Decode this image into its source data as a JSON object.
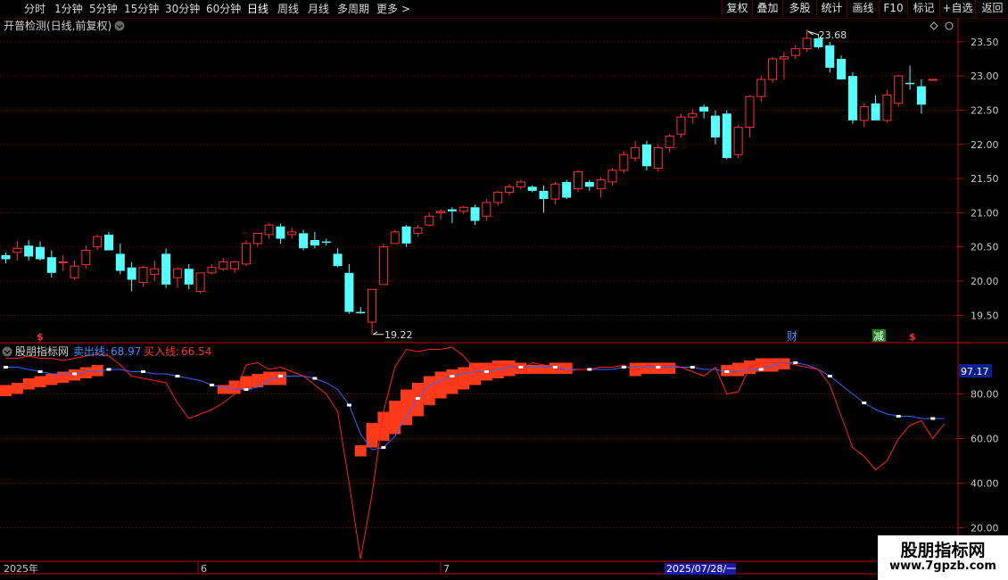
{
  "toolbar": {
    "periods": [
      "分时",
      "1分钟",
      "5分钟",
      "15分钟",
      "30分钟",
      "60分钟",
      "日线",
      "周线",
      "月线",
      "多周期",
      "更多 >"
    ],
    "active_period": "日线",
    "right_buttons": [
      "复权",
      "叠加",
      "多股",
      "统计",
      "画线",
      "F10",
      "标记",
      "+自选",
      "返回"
    ]
  },
  "main_panel": {
    "title": "开普检测(日线,前复权)",
    "high_label": "23.68",
    "low_label": "19.22",
    "markers": {
      "s1": "$",
      "s2": "$",
      "cai": "财",
      "jian": "减"
    }
  },
  "indicator_panel": {
    "title": "股朋指标网",
    "sell_label": "卖出线:",
    "sell_value": "68.97",
    "buy_label": "买入线:",
    "buy_value": "66.54",
    "current_value": "97.17"
  },
  "time_axis": {
    "labels": [
      "2025年",
      "6",
      "7"
    ],
    "cursor_date": "2025/07/28/一"
  },
  "watermark": {
    "title": "股朋指标网",
    "url": "www.7gpzb.com"
  },
  "colors": {
    "up": "#ff3232",
    "down": "#54ffff",
    "sell_line": "#3366ff",
    "buy_line": "#ff2020",
    "block": "#ff3a1a",
    "grid": "#8a0000",
    "axis": "#c00000"
  },
  "chart_data": [
    {
      "type": "candlestick",
      "title": "开普检测(日线,前复权)",
      "y_ticks": [
        19.5,
        20.0,
        20.5,
        21.0,
        21.5,
        22.0,
        22.5,
        23.0,
        23.5
      ],
      "ylim": [
        19.1,
        23.85
      ],
      "ohlc": [
        [
          20.38,
          20.42,
          20.26,
          20.32
        ],
        [
          20.42,
          20.58,
          20.3,
          20.48
        ],
        [
          20.52,
          20.6,
          20.3,
          20.36
        ],
        [
          20.5,
          20.58,
          20.3,
          20.32
        ],
        [
          20.35,
          20.45,
          20.05,
          20.12
        ],
        [
          20.28,
          20.38,
          20.15,
          20.28
        ],
        [
          20.05,
          20.3,
          20.02,
          20.22
        ],
        [
          20.24,
          20.52,
          20.18,
          20.45
        ],
        [
          20.5,
          20.68,
          20.45,
          20.65
        ],
        [
          20.68,
          20.72,
          20.45,
          20.45
        ],
        [
          20.4,
          20.55,
          20.1,
          20.15
        ],
        [
          20.2,
          20.28,
          19.85,
          20.02
        ],
        [
          19.98,
          20.22,
          19.92,
          20.2
        ],
        [
          20.1,
          20.3,
          20.0,
          20.18
        ],
        [
          20.4,
          20.48,
          19.9,
          19.95
        ],
        [
          20.05,
          20.2,
          19.9,
          20.18
        ],
        [
          20.18,
          20.25,
          19.88,
          19.95
        ],
        [
          19.85,
          20.12,
          19.82,
          20.12
        ],
        [
          20.12,
          20.25,
          20.1,
          20.2
        ],
        [
          20.18,
          20.34,
          20.15,
          20.28
        ],
        [
          20.18,
          20.3,
          20.12,
          20.28
        ],
        [
          20.25,
          20.6,
          20.22,
          20.55
        ],
        [
          20.55,
          20.7,
          20.5,
          20.7
        ],
        [
          20.68,
          20.85,
          20.62,
          20.82
        ],
        [
          20.8,
          20.84,
          20.55,
          20.62
        ],
        [
          20.68,
          20.78,
          20.62,
          20.72
        ],
        [
          20.7,
          20.75,
          20.45,
          20.48
        ],
        [
          20.6,
          20.72,
          20.48,
          20.52
        ],
        [
          20.58,
          20.62,
          20.52,
          20.56
        ],
        [
          20.4,
          20.48,
          20.2,
          20.22
        ],
        [
          20.12,
          20.25,
          19.52,
          19.55
        ],
        [
          19.55,
          19.62,
          19.52,
          19.53
        ],
        [
          19.4,
          19.88,
          19.22,
          19.88
        ],
        [
          19.95,
          20.55,
          19.95,
          20.5
        ],
        [
          20.55,
          20.75,
          20.55,
          20.72
        ],
        [
          20.8,
          20.82,
          20.5,
          20.55
        ],
        [
          20.7,
          20.82,
          20.65,
          20.78
        ],
        [
          20.82,
          21.0,
          20.8,
          20.95
        ],
        [
          21.0,
          21.05,
          20.9,
          21.02
        ],
        [
          21.05,
          21.08,
          20.85,
          21.02
        ],
        [
          21.02,
          21.1,
          20.98,
          21.08
        ],
        [
          21.08,
          21.12,
          20.82,
          20.88
        ],
        [
          20.95,
          21.2,
          20.88,
          21.15
        ],
        [
          21.15,
          21.32,
          21.1,
          21.3
        ],
        [
          21.3,
          21.42,
          21.25,
          21.38
        ],
        [
          21.38,
          21.48,
          21.34,
          21.45
        ],
        [
          21.38,
          21.4,
          21.3,
          21.32
        ],
        [
          21.32,
          21.4,
          21.0,
          21.2
        ],
        [
          21.2,
          21.45,
          21.12,
          21.42
        ],
        [
          21.45,
          21.48,
          21.2,
          21.22
        ],
        [
          21.35,
          21.62,
          21.3,
          21.6
        ],
        [
          21.45,
          21.48,
          21.32,
          21.38
        ],
        [
          21.35,
          21.52,
          21.22,
          21.48
        ],
        [
          21.45,
          21.65,
          21.4,
          21.62
        ],
        [
          21.62,
          21.9,
          21.58,
          21.85
        ],
        [
          21.8,
          22.05,
          21.75,
          21.95
        ],
        [
          22.0,
          22.05,
          21.62,
          21.68
        ],
        [
          21.65,
          22.0,
          21.6,
          21.95
        ],
        [
          21.95,
          22.15,
          21.88,
          22.12
        ],
        [
          22.15,
          22.45,
          22.1,
          22.4
        ],
        [
          22.4,
          22.52,
          22.3,
          22.45
        ],
        [
          22.55,
          22.58,
          22.38,
          22.48
        ],
        [
          22.42,
          22.5,
          22.0,
          22.1
        ],
        [
          22.45,
          22.5,
          21.78,
          21.8
        ],
        [
          21.85,
          22.28,
          21.8,
          22.25
        ],
        [
          22.25,
          22.72,
          22.1,
          22.7
        ],
        [
          22.7,
          23.0,
          22.62,
          22.95
        ],
        [
          22.95,
          23.28,
          22.9,
          23.25
        ],
        [
          23.25,
          23.35,
          22.95,
          23.28
        ],
        [
          23.3,
          23.45,
          23.25,
          23.4
        ],
        [
          23.4,
          23.68,
          23.35,
          23.55
        ],
        [
          23.55,
          23.62,
          23.4,
          23.42
        ],
        [
          23.45,
          23.5,
          23.05,
          23.12
        ],
        [
          23.25,
          23.3,
          22.95,
          22.95
        ],
        [
          23.0,
          23.05,
          22.3,
          22.35
        ],
        [
          22.35,
          22.6,
          22.25,
          22.55
        ],
        [
          22.6,
          22.72,
          22.35,
          22.35
        ],
        [
          22.35,
          22.8,
          22.32,
          22.72
        ],
        [
          22.6,
          23.02,
          22.55,
          23.0
        ],
        [
          22.9,
          23.15,
          22.8,
          22.88
        ],
        [
          22.85,
          22.95,
          22.45,
          22.58
        ],
        [
          22.95,
          22.95,
          22.95,
          22.95
        ]
      ]
    },
    {
      "type": "line",
      "title": "股朋指标网",
      "y_ticks": [
        20.0,
        40.0,
        60.0,
        80.0
      ],
      "ylim": [
        5,
        103
      ],
      "series": [
        {
          "name": "卖出线",
          "values": [
            92,
            92,
            91,
            90,
            89,
            89,
            89,
            90,
            90,
            91,
            91,
            90,
            90,
            89,
            89,
            88,
            87,
            86,
            84,
            83,
            82,
            82,
            83,
            86,
            88,
            88,
            88,
            87,
            85,
            82,
            75,
            62,
            55,
            56,
            61,
            70,
            78,
            84,
            86,
            88,
            89,
            90,
            90,
            91,
            92,
            92,
            92,
            92,
            92,
            91,
            91,
            91,
            91,
            91,
            92,
            92,
            92,
            92,
            92,
            92,
            92,
            91,
            91,
            90,
            90,
            91,
            91,
            93,
            94,
            94,
            93,
            91,
            88,
            84,
            80,
            76,
            73,
            71,
            70,
            70,
            69,
            69,
            68.97
          ]
        },
        {
          "name": "买入线",
          "values": [
            96,
            96,
            97,
            96,
            96,
            95,
            96,
            97,
            98,
            97,
            93,
            88,
            87,
            86,
            85,
            76,
            69,
            71,
            73,
            76,
            80,
            93,
            94,
            91,
            92,
            90,
            88,
            84,
            80,
            72,
            40,
            6,
            35,
            72,
            92,
            100,
            99,
            100,
            100,
            101,
            97,
            91,
            93,
            93,
            93,
            91,
            94,
            93,
            92,
            90,
            91,
            91,
            92,
            92,
            93,
            90,
            93,
            92,
            93,
            92,
            90,
            88,
            92,
            80,
            81,
            92,
            94,
            94,
            94,
            93,
            92,
            91,
            84,
            70,
            56,
            52,
            46,
            50,
            60,
            66,
            68,
            60,
            66.54
          ]
        }
      ],
      "signal_blocks": [
        [
          0,
          82,
          81
        ],
        [
          1,
          82,
          83
        ],
        [
          2,
          84,
          85
        ],
        [
          3,
          85,
          86
        ],
        [
          4,
          86,
          87
        ],
        [
          5,
          87,
          88
        ],
        [
          6,
          88,
          89
        ],
        [
          7,
          89,
          90
        ],
        [
          8,
          90,
          91
        ],
        [
          19,
          82,
          82
        ],
        [
          20,
          82,
          84
        ],
        [
          21,
          84,
          86
        ],
        [
          22,
          85,
          87
        ],
        [
          23,
          86,
          88
        ],
        [
          24,
          86,
          88
        ],
        [
          31,
          54,
          55
        ],
        [
          32,
          58,
          65
        ],
        [
          33,
          61,
          70
        ],
        [
          34,
          64,
          75
        ],
        [
          35,
          68,
          80
        ],
        [
          36,
          72,
          83
        ],
        [
          37,
          77,
          86
        ],
        [
          38,
          80,
          88
        ],
        [
          39,
          82,
          89
        ],
        [
          40,
          84,
          90
        ],
        [
          41,
          86,
          92
        ],
        [
          42,
          88,
          92
        ],
        [
          43,
          89,
          93
        ],
        [
          44,
          90,
          93
        ],
        [
          45,
          91,
          92
        ],
        [
          46,
          91,
          91
        ],
        [
          47,
          91,
          91
        ],
        [
          48,
          91,
          92
        ],
        [
          49,
          91,
          92
        ],
        [
          55,
          90,
          92
        ],
        [
          56,
          91,
          92
        ],
        [
          57,
          91,
          92
        ],
        [
          58,
          91,
          92
        ],
        [
          63,
          90,
          91
        ],
        [
          64,
          90,
          92
        ],
        [
          65,
          91,
          93
        ],
        [
          66,
          92,
          94
        ],
        [
          67,
          92,
          94
        ],
        [
          68,
          93,
          94
        ]
      ]
    }
  ]
}
